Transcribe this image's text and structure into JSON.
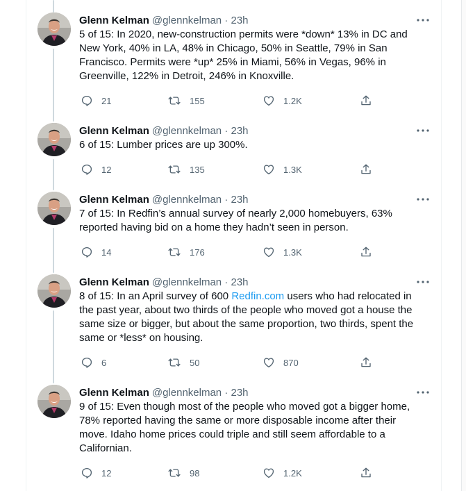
{
  "tweets": [
    {
      "name": "Glenn Kelman",
      "handle": "@glennkelman · 23h",
      "text": "5 of 15: In 2020, new-construction permits were *down* 13% in DC and New York, 40% in LA, 48% in Chicago, 50% in Seattle, 79% in San Francisco. Permits were *up* 25% in Miami, 56% in Vegas, 96% in Greenville, 122% in Detroit, 246% in Knoxville.",
      "replies": "21",
      "retweets": "155",
      "likes": "1.2K"
    },
    {
      "name": "Glenn Kelman",
      "handle": "@glennkelman · 23h",
      "text": "6 of 15: Lumber prices are up 300%.",
      "replies": "12",
      "retweets": "135",
      "likes": "1.3K"
    },
    {
      "name": "Glenn Kelman",
      "handle": "@glennkelman · 23h",
      "text": "7 of 15: In Redfin’s annual survey of nearly 2,000 homebuyers, 63% reported having bid on a home they hadn’t seen in person.",
      "replies": "14",
      "retweets": "176",
      "likes": "1.3K"
    },
    {
      "name": "Glenn Kelman",
      "handle": "@glennkelman · 23h",
      "text_before": "8 of 15: In an April survey of 600 ",
      "text_link": "Redfin.com",
      "text_after": " users who had relocated in the past year, about two thirds of the people who moved got a house the same size or bigger, but about the same proportion, two thirds, spent the same or *less* on housing.",
      "replies": "6",
      "retweets": "50",
      "likes": "870"
    },
    {
      "name": "Glenn Kelman",
      "handle": "@glennkelman · 23h",
      "text": "9 of 15: Even though most of the people who moved got a bigger home, 78% reported having the same or more disposable income after their move. Idaho home prices could triple and still seem affordable to a Californian.",
      "replies": "12",
      "retweets": "98",
      "likes": "1.2K"
    }
  ],
  "icons": {
    "more": "more-dots-icon",
    "reply": "reply-icon",
    "retweet": "retweet-icon",
    "like": "heart-icon",
    "share": "share-icon"
  },
  "colors": {
    "text": "#0f1419",
    "secondary": "#536471",
    "link": "#1d9bf0",
    "thread_line": "#cfd9de"
  }
}
